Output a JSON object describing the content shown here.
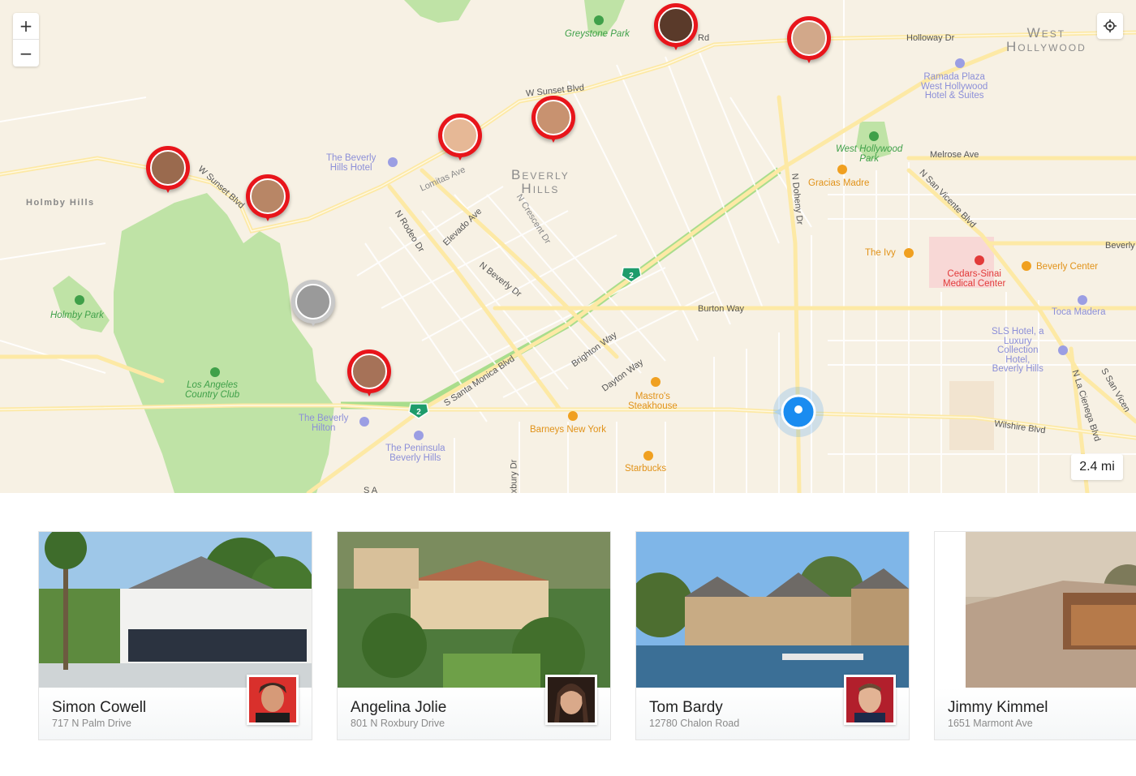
{
  "map": {
    "controls": {
      "zoom_in": "+",
      "zoom_out": "−",
      "locate_icon": "crosshair-icon"
    },
    "scale": "2.4 mi",
    "districts": {
      "west_hollywood": [
        "West",
        "Hollywood"
      ],
      "beverly_hills": [
        "Beverly",
        "Hills"
      ],
      "holmby_hills": "Holmby Hills"
    },
    "streets": {
      "sunset_top": "W Sunset Blvd",
      "sunset_left": "W Sunset Blvd",
      "rd": "Rd",
      "holloway": "Holloway Dr",
      "melrose": "Melrose Ave",
      "lomitas": "Lomitas Ave",
      "elevado": "Elevado Ave",
      "rodeo": "N Rodeo Dr",
      "crescent": "N Crescent Dr",
      "beverly_dr": "N Beverly Dr",
      "doheny": "N Doheny Dr",
      "san_vicente": "N San Vicente Blvd",
      "burton": "Burton Way",
      "brighton": "Brighton Way",
      "dayton": "Dayton Way",
      "santa_monica": "S Santa Monica Blvd",
      "wilshire": "Wilshire Blvd",
      "la_cienega": "N La Cienega Blvd",
      "s_san_vicente": "S San Vicen",
      "beverly_right": "Beverly",
      "roxbury": "oxbury Dr",
      "s_bottom": "S A"
    },
    "highway_shield": "2",
    "pois": {
      "greystone": "Greystone Park",
      "beverly_hills_hotel": [
        "The Beverly",
        "Hills Hotel"
      ],
      "ramada": [
        "Ramada Plaza",
        "West Hollywood",
        "Hotel & Suites"
      ],
      "wh_park": [
        "West Hollywood",
        "Park"
      ],
      "gracias": "Gracias Madre",
      "ivy": "The Ivy",
      "cedars": [
        "Cedars-Sinai",
        "Medical Center"
      ],
      "beverly_center": "Beverly Center",
      "toca": "Toca Madera",
      "sls": [
        "SLS Hotel, a",
        "Luxury",
        "Collection",
        "Hotel,",
        "Beverly Hills"
      ],
      "holmby_park": "Holmby Park",
      "lacc": [
        "Los Angeles",
        "Country Club"
      ],
      "beverly_hilton": [
        "The Beverly",
        "Hilton"
      ],
      "peninsula": [
        "The Peninsula",
        "Beverly Hills"
      ],
      "mastros": [
        "Mastro's",
        "Steakhouse"
      ],
      "barneys": "Barneys New York",
      "starbucks": "Starbucks"
    },
    "pins": [
      {
        "name": "pin-celebrity-1",
        "color": "#e8151b"
      },
      {
        "name": "pin-celebrity-2",
        "color": "#e8151b"
      },
      {
        "name": "pin-simon-cowell",
        "color": "#e8151b"
      },
      {
        "name": "pin-celebrity-4",
        "color": "#e8151b"
      },
      {
        "name": "pin-celebrity-5",
        "color": "#e8151b"
      },
      {
        "name": "pin-celebrity-6",
        "color": "#e8151b"
      },
      {
        "name": "pin-celebrity-7",
        "color": "#c8c8c8"
      },
      {
        "name": "pin-angelina-jolie",
        "color": "#e8151b"
      }
    ],
    "colors": {
      "background": "#f7f1e4",
      "park": "#bfe3a6",
      "road_major": "#fde9a5",
      "accent_pin": "#e8151b",
      "user_location": "#1a8cf0"
    }
  },
  "cards": [
    {
      "name": "Simon Cowell",
      "address": "717 N Palm Drive"
    },
    {
      "name": "Angelina Jolie",
      "address": "801 N Roxbury Drive"
    },
    {
      "name": "Tom Bardy",
      "address": "12780 Chalon Road"
    },
    {
      "name": "Jimmy Kimmel",
      "address": "1651 Marmont Ave"
    }
  ]
}
